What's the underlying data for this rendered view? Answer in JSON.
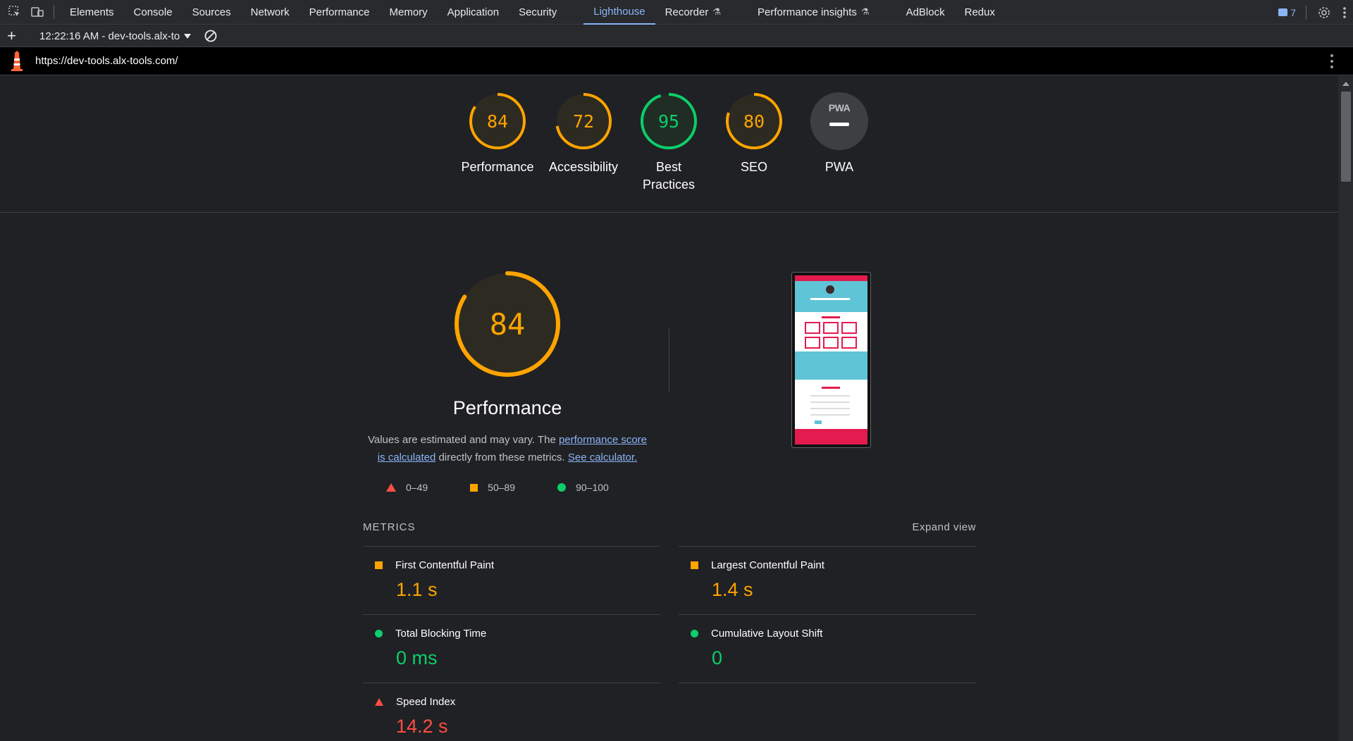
{
  "devtools": {
    "tabs": [
      {
        "label": "Elements"
      },
      {
        "label": "Console"
      },
      {
        "label": "Sources"
      },
      {
        "label": "Network"
      },
      {
        "label": "Performance"
      },
      {
        "label": "Memory"
      },
      {
        "label": "Application"
      },
      {
        "label": "Security"
      },
      {
        "label": "Lighthouse"
      },
      {
        "label": "Recorder"
      },
      {
        "label": "Performance insights"
      },
      {
        "label": "AdBlock"
      },
      {
        "label": "Redux"
      }
    ],
    "active_tab": "Lighthouse",
    "issues_count": "7",
    "icons": [
      "inspect-element-icon",
      "device-toolbar-icon",
      "issues-icon",
      "settings-gear-icon",
      "more-options-icon"
    ]
  },
  "toolbar": {
    "run_label": "12:22:16 AM - dev-tools.alx-to",
    "icons": [
      "add-icon",
      "clear-icon"
    ]
  },
  "urlbar": {
    "url": "https://dev-tools.alx-tools.com/"
  },
  "scores": {
    "performance": {
      "label": "Performance",
      "value": "84",
      "color": "#ffa400"
    },
    "accessibility": {
      "label": "Accessibility",
      "value": "72",
      "color": "#ffa400"
    },
    "best_practices": {
      "label": "Best Practices",
      "value": "95",
      "color": "#0cce6b"
    },
    "seo": {
      "label": "SEO",
      "value": "80",
      "color": "#ffa400"
    },
    "pwa": {
      "label": "PWA",
      "badge": "PWA"
    }
  },
  "performance_section": {
    "score": "84",
    "title": "Performance",
    "desc_prefix": "Values are estimated and may vary. The ",
    "link_score": "performance score is calculated",
    "desc_middle": " directly from these metrics. ",
    "link_calculator": "See calculator.",
    "legend": [
      {
        "range": "0–49",
        "color": "#ff4e42"
      },
      {
        "range": "50–89",
        "color": "#ffa400"
      },
      {
        "range": "90–100",
        "color": "#0cce6b"
      }
    ]
  },
  "metrics": {
    "header": "METRICS",
    "expand": "Expand view",
    "items": [
      {
        "name": "First Contentful Paint",
        "value": "1.1 s",
        "rating": "average"
      },
      {
        "name": "Largest Contentful Paint",
        "value": "1.4 s",
        "rating": "average"
      },
      {
        "name": "Total Blocking Time",
        "value": "0 ms",
        "rating": "pass"
      },
      {
        "name": "Cumulative Layout Shift",
        "value": "0",
        "rating": "pass"
      },
      {
        "name": "Speed Index",
        "value": "14.2 s",
        "rating": "fail"
      }
    ]
  },
  "colors": {
    "fail": "#ff4e42",
    "average": "#ffa400",
    "pass": "#0cce6b",
    "link": "#8ab4f8",
    "background": "#202124"
  }
}
